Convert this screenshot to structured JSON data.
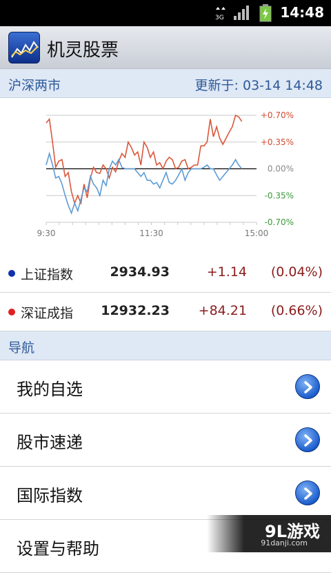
{
  "status_bar": {
    "network": "3G",
    "time": "14:48"
  },
  "app": {
    "title": "机灵股票"
  },
  "market_header": {
    "label": "沪深两市",
    "updated": "更新于: 03-14 14:48"
  },
  "chart_data": {
    "type": "line",
    "x_ticks": [
      "9:30",
      "11:30",
      "15:00"
    ],
    "y_ticks": [
      "+0.70%",
      "+0.35%",
      "0.00%",
      "-0.35%",
      "-0.70%"
    ],
    "ylim": [
      -0.7,
      0.7
    ],
    "grid": true,
    "series": [
      {
        "color": "#d9573a",
        "values": [
          0.6,
          0.65,
          0.35,
          0.02,
          0.1,
          0.12,
          -0.1,
          -0.05,
          -0.3,
          -0.45,
          -0.35,
          -0.45,
          -0.2,
          -0.38,
          -0.12,
          0.02,
          -0.05,
          -0.06,
          0.05,
          0.0,
          -0.12,
          0.02,
          -0.04,
          0.1,
          0.2,
          0.15,
          0.35,
          0.28,
          0.18,
          0.22,
          0.05,
          0.35,
          0.28,
          0.15,
          0.22,
          0.05,
          0.08,
          0.0,
          0.1,
          0.15,
          0.12,
          0.0,
          0.02,
          0.1,
          0.12,
          0.0,
          0.02,
          0.05,
          0.05,
          0.3,
          0.3,
          0.35,
          0.65,
          0.42,
          0.55,
          0.4,
          0.32,
          0.4,
          0.48,
          0.55,
          0.7,
          0.68,
          0.62
        ]
      },
      {
        "color": "#5b9bd5",
        "values": [
          0.05,
          0.2,
          0.05,
          -0.12,
          -0.1,
          -0.2,
          -0.35,
          -0.48,
          -0.58,
          -0.45,
          -0.55,
          -0.4,
          -0.25,
          -0.3,
          -0.1,
          -0.2,
          -0.25,
          -0.35,
          -0.15,
          -0.22,
          0.0,
          0.1,
          0.05,
          0.12,
          0.02,
          0.0,
          0.0,
          0.0,
          0.0,
          -0.05,
          -0.1,
          -0.05,
          -0.15,
          -0.15,
          -0.2,
          -0.18,
          -0.25,
          -0.15,
          -0.05,
          -0.18,
          -0.2,
          -0.15,
          -0.08,
          0.0,
          -0.15,
          -0.05,
          0.0,
          0.0,
          0.0,
          0.0,
          0.02,
          0.05,
          0.0,
          0.0,
          -0.08,
          -0.15,
          -0.1,
          -0.05,
          0.0,
          0.05,
          0.12,
          0.05,
          0.0
        ]
      }
    ]
  },
  "indices": [
    {
      "name": "上证指数",
      "value": "2934.93",
      "change": "+1.14",
      "percent": "(0.04%)",
      "dot_color": "#1030b0"
    },
    {
      "name": "深证成指",
      "value": "12932.23",
      "change": "+84.21",
      "percent": "(0.66%)",
      "dot_color": "#e02020"
    }
  ],
  "nav_section": {
    "label": "导航"
  },
  "nav_items": [
    {
      "label": "我的自选"
    },
    {
      "label": "股市速递"
    },
    {
      "label": "国际指数"
    },
    {
      "label": "设置与帮助"
    }
  ],
  "watermark": {
    "brand": "9L游戏",
    "site": "91danji.com"
  }
}
